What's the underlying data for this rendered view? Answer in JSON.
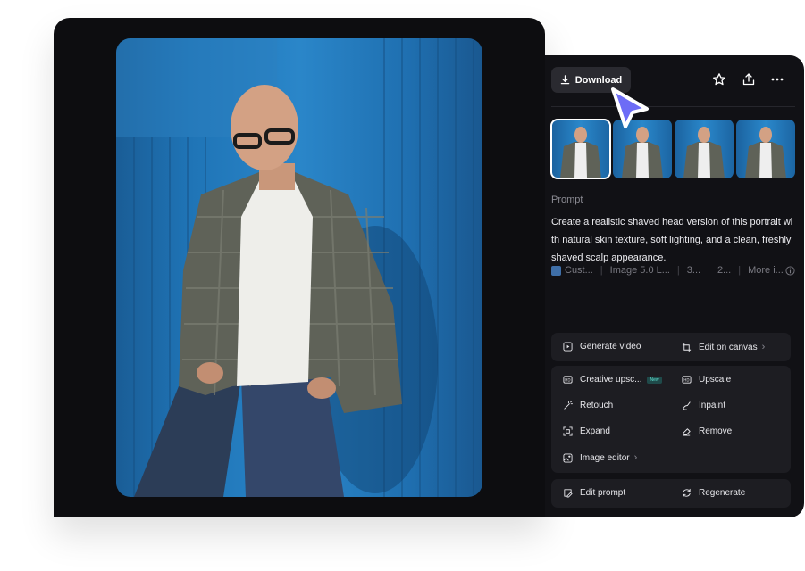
{
  "toolbar": {
    "download_label": "Download",
    "icons": [
      "star-icon",
      "share-icon",
      "more-icon"
    ]
  },
  "thumbnails": {
    "count": 4,
    "selected_index": 0
  },
  "prompt": {
    "label": "Prompt",
    "text": "Create a realistic shaved head version of this portrait with natural skin texture, soft lighting, and a clean, freshly shaved scalp appearance."
  },
  "meta": {
    "items": [
      "Cust...",
      "Image 5.0 L...",
      "3...",
      "2...",
      "More i..."
    ]
  },
  "actions": {
    "group1": [
      "Generate video",
      "Edit on canvas"
    ],
    "group2": [
      "Creative upsc...",
      "Upscale",
      "Retouch",
      "Inpaint",
      "Expand",
      "Remove",
      "Image editor"
    ],
    "group3": [
      "Edit prompt",
      "Regenerate"
    ],
    "new_badge": "New"
  },
  "colors": {
    "panel": "#111115",
    "card": "#0d0d10",
    "accent_cursor": "#6d6cf6",
    "photo_blue": "#1f74b6"
  }
}
